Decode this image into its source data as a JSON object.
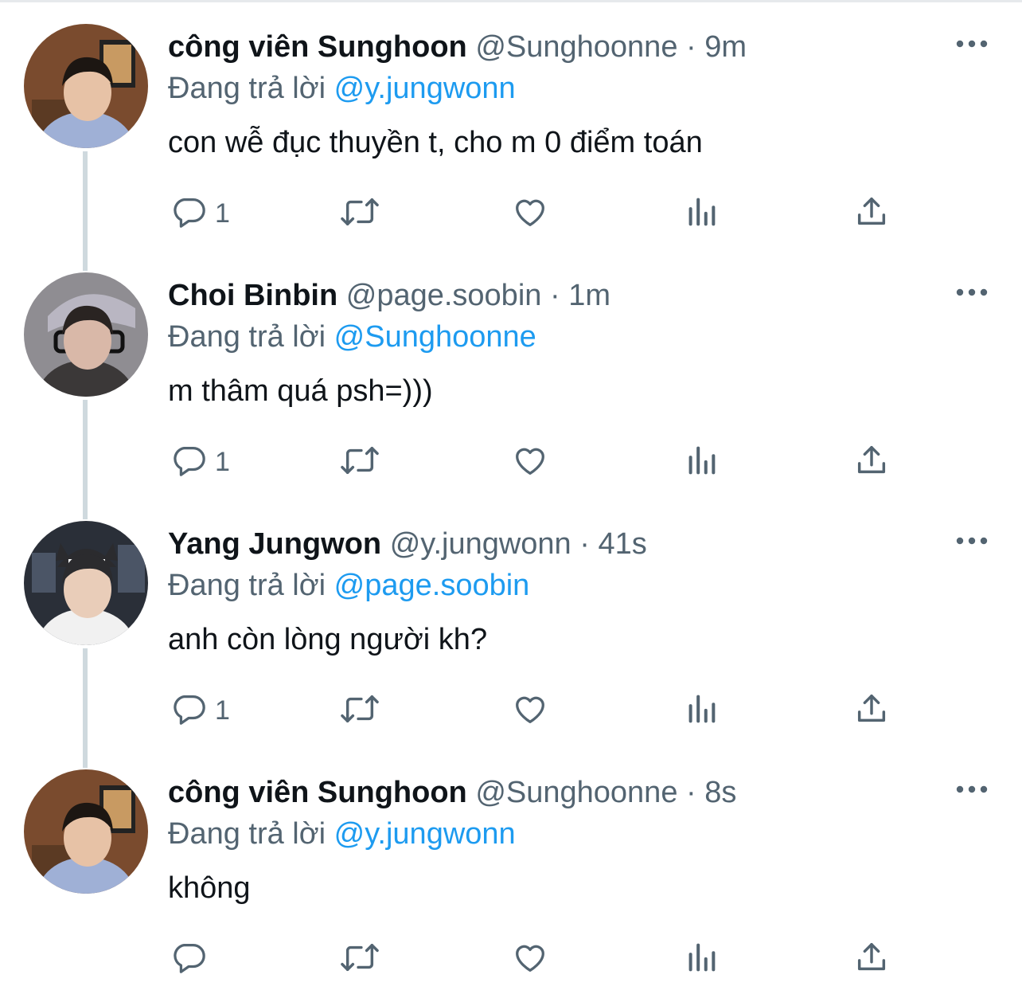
{
  "thread": {
    "tweets": [
      {
        "display_name": "công viên Sunghoon",
        "handle": "@Sunghoonne",
        "separator": "·",
        "time": "9m",
        "replying_label": "Đang trả lời",
        "replying_to": "@y.jungwonn",
        "text": "con wễ đục thuyền t, cho m 0 điểm toán",
        "reply_count": "1",
        "avatar_palette": {
          "bg": "#7a4b2e",
          "accent": "#c89a62",
          "skin": "#e7c2a6",
          "hair": "#1c1612",
          "shirt": "#9fb0d6"
        }
      },
      {
        "display_name": "Choi Binbin",
        "handle": "@page.soobin",
        "separator": "·",
        "time": "1m",
        "replying_label": "Đang trả lời",
        "replying_to": "@Sunghoonne",
        "text": "m thâm quá psh=)))",
        "reply_count": "1",
        "avatar_palette": {
          "bg": "#8f8d92",
          "accent": "#cfcfd3",
          "skin": "#d9b8a8",
          "hair": "#2a2422",
          "shirt": "#3b3838"
        }
      },
      {
        "display_name": "Yang Jungwon",
        "handle": "@y.jungwonn",
        "separator": "·",
        "time": "41s",
        "replying_label": "Đang trả lời",
        "replying_to": "@page.soobin",
        "text": "anh còn lòng người kh?",
        "reply_count": "1",
        "avatar_palette": {
          "bg": "#2a2f38",
          "accent": "#4b5566",
          "skin": "#e9cdb9",
          "hair": "#2b2b2e",
          "shirt": "#f1f1f1"
        }
      },
      {
        "display_name": "công viên Sunghoon",
        "handle": "@Sunghoonne",
        "separator": "·",
        "time": "8s",
        "replying_label": "Đang trả lời",
        "replying_to": "@y.jungwonn",
        "text": "không",
        "reply_count": "",
        "avatar_palette": {
          "bg": "#7a4b2e",
          "accent": "#c89a62",
          "skin": "#e7c2a6",
          "hair": "#1c1612",
          "shirt": "#9fb0d6"
        }
      }
    ]
  },
  "icons": {
    "reply": "reply-icon",
    "retweet": "retweet-icon",
    "like": "heart-icon",
    "views": "views-icon",
    "share": "share-icon",
    "more": "more-icon"
  },
  "colors": {
    "text": "#0f1419",
    "secondary": "#536471",
    "accent": "#1d9bf0",
    "thread_line": "#cfd9de"
  }
}
